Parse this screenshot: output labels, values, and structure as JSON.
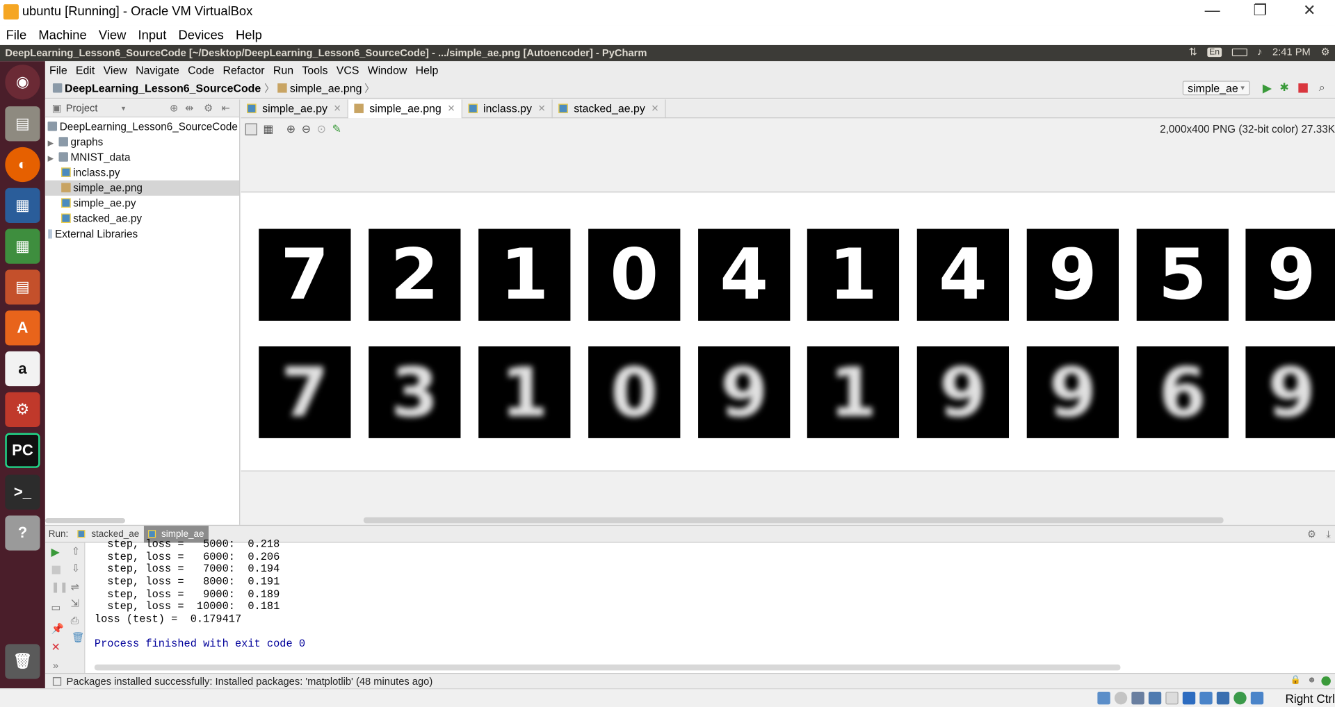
{
  "vbox": {
    "title": "ubuntu [Running] - Oracle VM VirtualBox",
    "menu": [
      "File",
      "Machine",
      "View",
      "Input",
      "Devices",
      "Help"
    ],
    "host_key": "Right Ctrl",
    "minimize": "—",
    "restore": "❐",
    "close": "✕"
  },
  "ubuntu_panel": {
    "title": "DeepLearning_Lesson6_SourceCode [~/Desktop/DeepLearning_Lesson6_SourceCode] - .../simple_ae.png [Autoencoder] - PyCharm",
    "keyboard": "En",
    "time": "2:41 PM"
  },
  "launcher": [
    "dash-icon",
    "files-icon",
    "firefox-icon",
    "writer-icon",
    "calc-icon",
    "impress-icon",
    "software-center-icon",
    "amazon-icon",
    "settings-icon",
    "pycharm-icon",
    "terminal-icon",
    "help-icon",
    "trash-icon"
  ],
  "pycharm": {
    "menu": [
      "File",
      "Edit",
      "View",
      "Navigate",
      "Code",
      "Refactor",
      "Run",
      "Tools",
      "VCS",
      "Window",
      "Help"
    ],
    "breadcrumb": {
      "project": "DeepLearning_Lesson6_SourceCode",
      "file": "simple_ae.png"
    },
    "run_config": "simple_ae",
    "project_panel": {
      "label": "Project",
      "root": "DeepLearning_Lesson6_SourceCode [",
      "items": [
        {
          "name": "graphs",
          "type": "folder"
        },
        {
          "name": "MNIST_data",
          "type": "folder"
        },
        {
          "name": "inclass.py",
          "type": "py"
        },
        {
          "name": "simple_ae.png",
          "type": "png"
        },
        {
          "name": "simple_ae.py",
          "type": "py"
        },
        {
          "name": "stacked_ae.py",
          "type": "py"
        }
      ],
      "external": "External Libraries"
    },
    "tabs": [
      {
        "label": "simple_ae.py",
        "active": false
      },
      {
        "label": "simple_ae.png",
        "active": true
      },
      {
        "label": "inclass.py",
        "active": false
      },
      {
        "label": "stacked_ae.py",
        "active": false
      }
    ],
    "image_info": "2,000x400 PNG (32-bit color) 27.33K",
    "digits_original": [
      "7",
      "2",
      "1",
      "0",
      "4",
      "1",
      "4",
      "9",
      "5",
      "9"
    ],
    "digits_reconstructed": [
      "7",
      "3",
      "1",
      "0",
      "9",
      "1",
      "9",
      "9",
      "6",
      "9"
    ],
    "run": {
      "label": "Run:",
      "tabs": [
        {
          "label": "stacked_ae",
          "active": false
        },
        {
          "label": "simple_ae",
          "active": true
        }
      ],
      "console": [
        "  step, loss =   5000:  0.218",
        "  step, loss =   6000:  0.206",
        "  step, loss =   7000:  0.194",
        "  step, loss =   8000:  0.191",
        "  step, loss =   9000:  0.189",
        "  step, loss =  10000:  0.181",
        "loss (test) =  0.179417"
      ],
      "finished": "Process finished with exit code 0"
    },
    "status": "Packages installed successfully: Installed packages: 'matplotlib' (48 minutes ago)"
  }
}
